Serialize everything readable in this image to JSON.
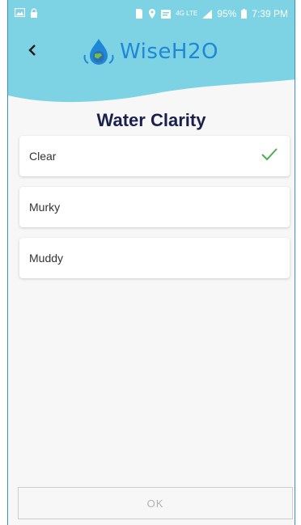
{
  "statusbar": {
    "left_icons": [
      "image-icon",
      "lock-icon"
    ],
    "right_icons": [
      "sim-icon",
      "location-icon",
      "notification-icon",
      "signal-icon"
    ],
    "network_label": "4G LTE",
    "battery": "95%",
    "time": "7:39 PM"
  },
  "header": {
    "back_icon": "chevron-left-icon",
    "app_name": "WiseH2O",
    "accent_color": "#7dd3e4",
    "brand_color": "#1e88d6"
  },
  "page": {
    "title": "Water Clarity"
  },
  "options": [
    {
      "label": "Clear",
      "selected": true
    },
    {
      "label": "Murky",
      "selected": false
    },
    {
      "label": "Muddy",
      "selected": false
    }
  ],
  "footer": {
    "ok_label": "OK",
    "ok_enabled": false
  },
  "colors": {
    "check": "#4caf50",
    "title": "#1b1f4b"
  }
}
